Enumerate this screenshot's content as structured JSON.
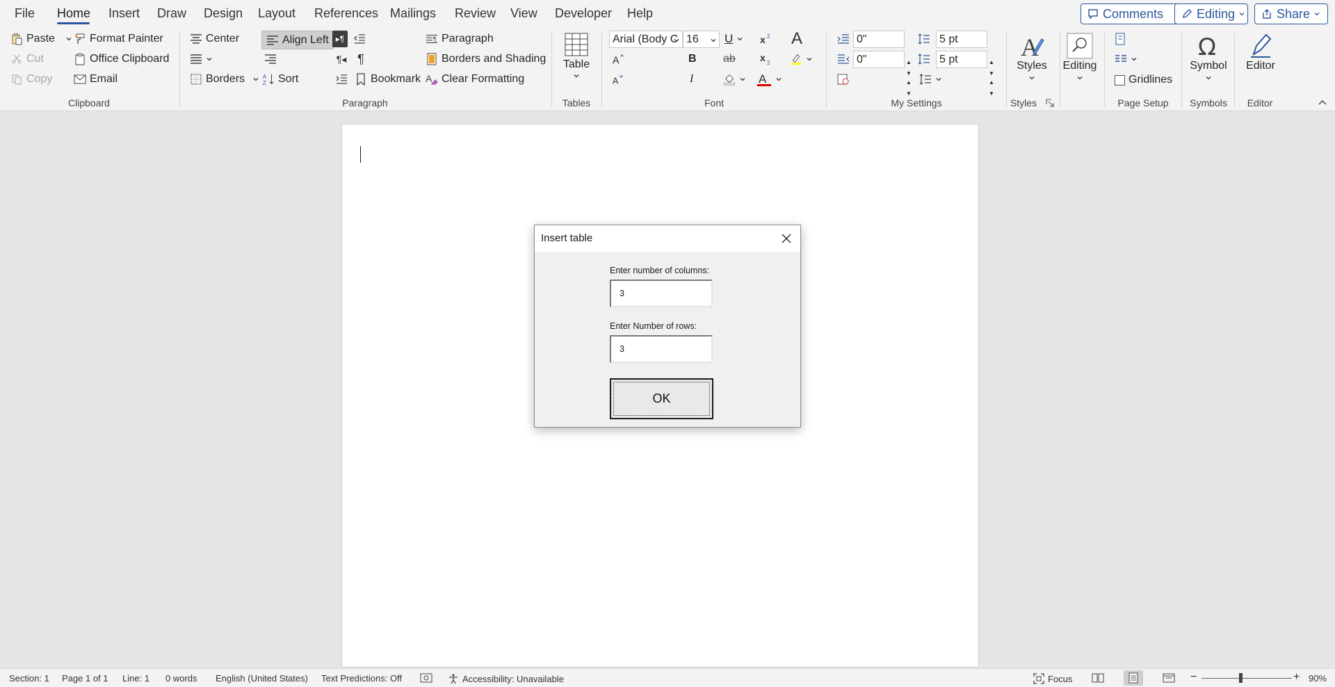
{
  "tabs": [
    "File",
    "Home",
    "Insert",
    "Draw",
    "Design",
    "Layout",
    "References",
    "Mailings",
    "Review",
    "View",
    "Developer",
    "Help"
  ],
  "active_tab": "Home",
  "header_buttons": {
    "comments": "Comments",
    "editing": "Editing",
    "share": "Share"
  },
  "ribbon": {
    "clipboard": {
      "paste": "Paste",
      "cut": "Cut",
      "copy": "Copy",
      "format_painter": "Format Painter",
      "office_clipboard": "Office Clipboard",
      "email": "Email",
      "label": "Clipboard"
    },
    "paragraph": {
      "center": "Center",
      "align_left": "Align Left",
      "borders": "Borders",
      "sort": "Sort",
      "bookmark": "Bookmark",
      "paragraph": "Paragraph",
      "borders_and_shading": "Borders and Shading",
      "clear_formatting": "Clear Formatting",
      "label": "Paragraph"
    },
    "tables": {
      "table": "Table",
      "label": "Tables"
    },
    "font": {
      "font_name": "Arial (Body C",
      "font_size": "16",
      "bold": "B",
      "italic": "I",
      "underline": "U",
      "strikethrough": "ab",
      "label": "Font"
    },
    "my_settings": {
      "indent_left": "0\"",
      "indent_right": "0\"",
      "space_before": "5 pt",
      "space_after": "5 pt",
      "label": "My Settings"
    },
    "styles": {
      "styles": "Styles",
      "label": "Styles"
    },
    "editing_group": {
      "editing": "Editing"
    },
    "page_setup": {
      "gridlines": "Gridlines",
      "label": "Page Setup"
    },
    "symbols": {
      "symbol": "Symbol",
      "label": "Symbols"
    },
    "editor": {
      "editor": "Editor",
      "label": "Editor"
    }
  },
  "dialog": {
    "title": "Insert table",
    "columns_label": "Enter number of columns:",
    "columns_value": "3",
    "rows_label": "Enter Number of rows:",
    "rows_value": "3",
    "ok": "OK"
  },
  "status_bar": {
    "section": "Section: 1",
    "page": "Page 1 of 1",
    "line": "Line: 1",
    "words": "0 words",
    "language": "English (United States)",
    "text_predictions": "Text Predictions: Off",
    "accessibility": "Accessibility: Unavailable",
    "focus": "Focus",
    "zoom": "90%"
  },
  "colors": {
    "accent": "#2b579a",
    "font_color": "#e00000",
    "highlight": "#ffff00"
  }
}
